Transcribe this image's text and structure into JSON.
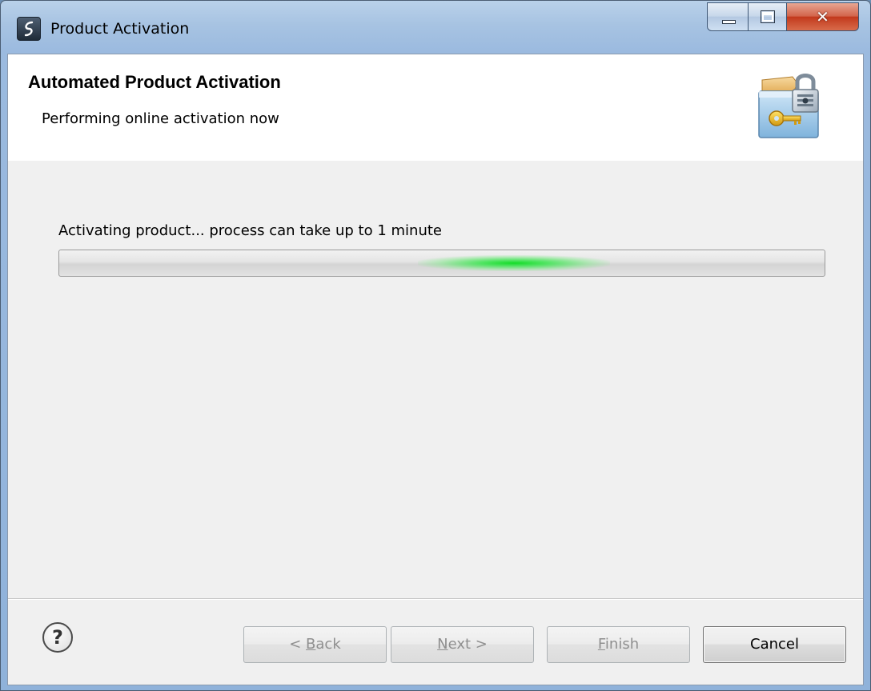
{
  "window": {
    "title": "Product Activation"
  },
  "banner": {
    "title": "Automated Product Activation",
    "subtitle": "Performing online activation now",
    "icon": "lock-key-folder-icon"
  },
  "status": {
    "message": "Activating product... process can take up to 1 minute",
    "progress_mode": "indeterminate"
  },
  "buttons": {
    "back": {
      "mnemonic": "B",
      "rest": "ack",
      "prefix": "< ",
      "enabled": false
    },
    "next": {
      "mnemonic": "N",
      "rest": "ext >",
      "enabled": false
    },
    "finish": {
      "mnemonic": "F",
      "rest": "inish",
      "enabled": false
    },
    "cancel": {
      "label": "Cancel",
      "enabled": true
    }
  },
  "help": {
    "glyph": "?"
  },
  "colors": {
    "progress_glow": "#14dc28",
    "close_button": "#c2391c",
    "titlebar": "#a7c3e2"
  }
}
